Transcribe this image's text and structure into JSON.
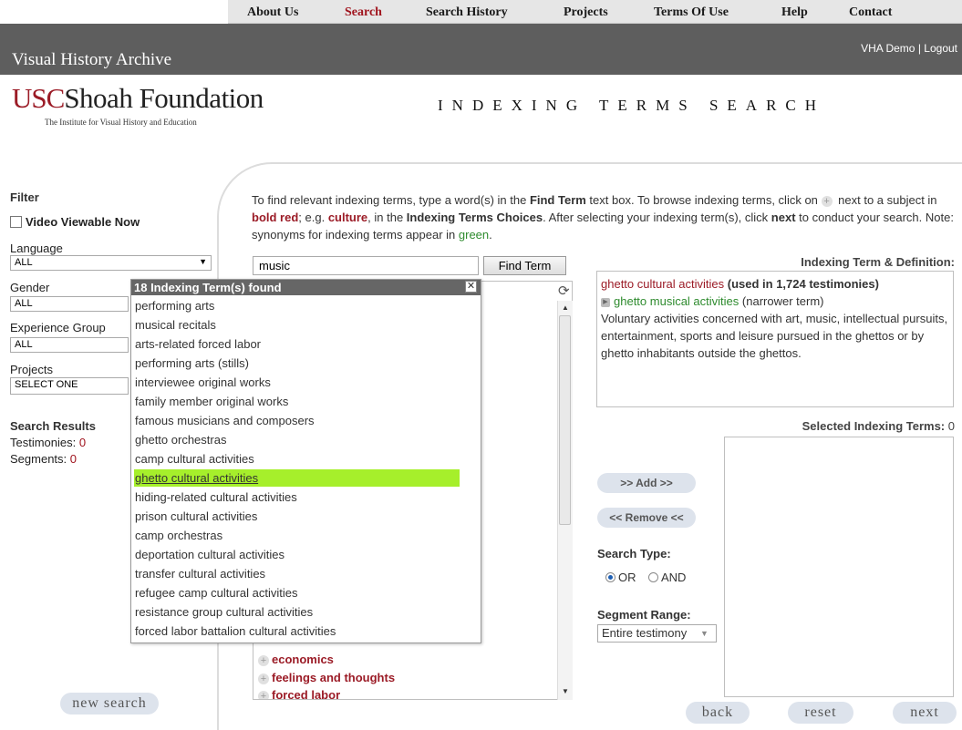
{
  "nav": {
    "items": [
      "About Us",
      "Search",
      "Search History",
      "Projects",
      "Terms Of Use",
      "Help",
      "Contact"
    ],
    "active": "Search"
  },
  "header": {
    "app_title": "Visual History Archive",
    "user": "VHA Demo",
    "separator": "|",
    "logout": "Logout"
  },
  "logo": {
    "usc": "USC",
    "shoah": "Shoah Foundation",
    "tagline": "The Institute for Visual History and Education"
  },
  "page_heading": "INDEXING TERMS SEARCH",
  "sidebar": {
    "filter_label": "Filter",
    "video_viewable_label": "Video Viewable Now",
    "language_label": "Language",
    "language_value": "ALL",
    "gender_label": "Gender",
    "gender_value": "ALL",
    "experience_label": "Experience Group",
    "experience_value": "ALL",
    "projects_label": "Projects",
    "projects_value": "SELECT ONE",
    "results_label": "Search Results",
    "testimonies_label": "Testimonies:",
    "testimonies_value": "0",
    "segments_label": "Segments:",
    "segments_value": "0",
    "new_search": "new search"
  },
  "instructions": {
    "p1": "To find relevant indexing terms, type a word(s) in the ",
    "find_term": "Find Term",
    "p2": " text box. To browse indexing terms, click on ",
    "p3": " next to a subject in ",
    "bold_red": "bold red",
    "p4": "; e.g. ",
    "culture": "culture",
    "p5": ", in the ",
    "choices": "Indexing Terms Choices",
    "p6": ". After selecting your indexing term(s), click ",
    "next": "next",
    "p7": " to conduct your search. Note: synonyms for indexing terms appear in ",
    "green": "green",
    "p8": "."
  },
  "search": {
    "input_value": "music",
    "find_button": "Find Term"
  },
  "choices_visible": [
    "economics",
    "feelings and thoughts",
    "forced labor"
  ],
  "dropdown": {
    "header": "18 Indexing Term(s) found",
    "close": "✕",
    "items": [
      "performing arts",
      "musical recitals",
      "arts-related forced labor",
      "performing arts (stills)",
      "interviewee original works",
      "family member original works",
      "famous musicians and composers",
      "ghetto orchestras",
      "camp cultural activities",
      "ghetto cultural activities",
      "hiding-related cultural activities",
      "prison cultural activities",
      "camp orchestras",
      "deportation cultural activities",
      "transfer cultural activities",
      "refugee camp cultural activities",
      "resistance group cultural activities",
      "forced labor battalion cultural activities"
    ],
    "selected_index": 9
  },
  "definition": {
    "heading": "Indexing Term & Definition:",
    "term": "ghetto cultural activities",
    "used": "(used in 1,724 testimonies)",
    "narrower": "ghetto musical activities",
    "narrower_note": "(narrower term)",
    "text": "Voluntary activities concerned with art, music, intellectual pursuits, entertainment, sports and leisure pursued in the ghettos or by ghetto inhabitants outside the ghettos."
  },
  "selected": {
    "heading": "Selected Indexing Terms:",
    "count": "0"
  },
  "actions": {
    "add": ">> Add >>",
    "remove": "<< Remove <<",
    "search_type_label": "Search Type:",
    "or": "OR",
    "and": "AND",
    "search_type_value": "OR",
    "segment_label": "Segment Range:",
    "segment_value": "Entire testimony",
    "back": "back",
    "reset": "reset",
    "next": "next"
  },
  "colors": {
    "accent_red": "#9b1b26",
    "synonym_green": "#2e8b2e",
    "highlight": "#a6ef2b"
  }
}
